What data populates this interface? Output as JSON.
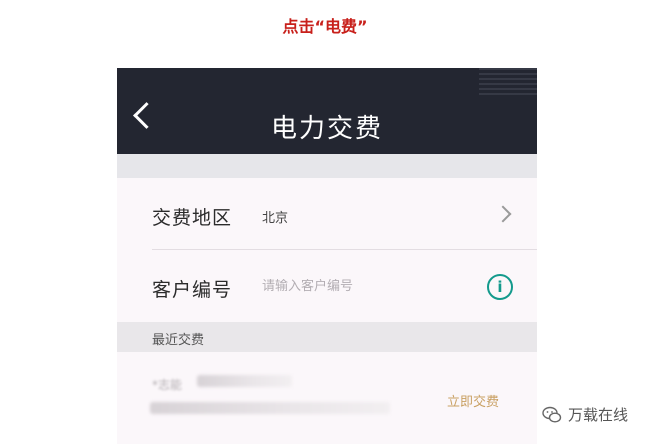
{
  "caption": "点击“电费”",
  "navbar": {
    "title": "电力交费"
  },
  "form": {
    "region": {
      "label": "交费地区",
      "value": "北京"
    },
    "customer": {
      "label": "客户编号",
      "placeholder": "请输入客户编号"
    }
  },
  "recent": {
    "section_title": "最近交费",
    "item": {
      "name": "*志能",
      "pay_label": "立即交费"
    }
  },
  "watermark": {
    "text": "万载在线"
  },
  "colors": {
    "navbar_bg": "#232631",
    "caption": "#c8201b",
    "info_icon": "#139a8c",
    "pay_link": "#c9a062"
  }
}
